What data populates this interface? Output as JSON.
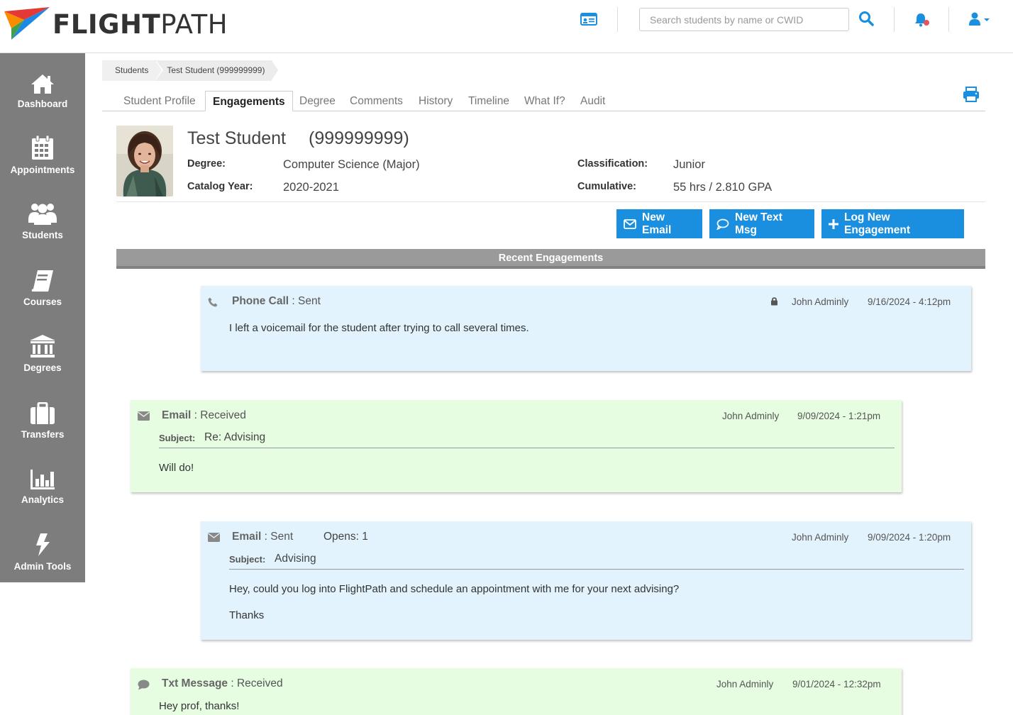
{
  "header": {
    "logo_bold": "FLIGHT",
    "logo_light": "PATH",
    "search_placeholder": "Search students by name or CWID",
    "icons": [
      "id-card-icon",
      "search-icon",
      "bell-icon",
      "user-icon"
    ]
  },
  "sidebar": {
    "items": [
      {
        "label": "Dashboard",
        "icon": "home-icon"
      },
      {
        "label": "Appointments",
        "icon": "calendar-icon"
      },
      {
        "label": "Students",
        "icon": "users-icon"
      },
      {
        "label": "Courses",
        "icon": "book-icon"
      },
      {
        "label": "Degrees",
        "icon": "university-icon"
      },
      {
        "label": "Transfers",
        "icon": "suitcase-icon"
      },
      {
        "label": "Analytics",
        "icon": "bar-chart-icon"
      },
      {
        "label": "Admin Tools",
        "icon": "bolt-icon"
      }
    ]
  },
  "breadcrumb": [
    "Students",
    "Test Student (999999999)"
  ],
  "tabs": [
    "Student Profile",
    "Engagements",
    "Degree",
    "Comments",
    "History",
    "Timeline",
    "What If?",
    "Audit"
  ],
  "active_tab": "Engagements",
  "student": {
    "name": "Test Student",
    "cwid": "(999999999)",
    "degree_label": "Degree:",
    "degree": "Computer Science (Major)",
    "catalog_label": "Catalog Year:",
    "catalog": "2020-2021",
    "class_label": "Classification:",
    "classification": "Junior",
    "cum_label": "Cumulative:",
    "cumulative": "55 hrs / 2.810 GPA"
  },
  "actions": {
    "new_email": "New Email",
    "new_text": "New Text Msg",
    "log_engagement": "Log New Engagement"
  },
  "recent_title": "Recent Engagements",
  "engagements": [
    {
      "type": "Phone Call",
      "status": ": Sent",
      "author": "John Adminly",
      "date": "9/16/2024 - 4:12pm",
      "body": "I left a voicemail for the student after trying to call several times."
    },
    {
      "type": "Email",
      "status": ": Received",
      "author": "John Adminly",
      "date": "9/09/2024 - 1:21pm",
      "subject_label": "Subject:",
      "subject": "Re: Advising",
      "body": "Will do!"
    },
    {
      "type": "Email",
      "status": ": Sent",
      "opens": "Opens: 1",
      "author": "John Adminly",
      "date": "9/09/2024 - 1:20pm",
      "subject_label": "Subject:",
      "subject": "Advising",
      "body": "Hey, could you log into FlightPath and schedule an appointment with me for your next advising?",
      "body2": "Thanks"
    },
    {
      "type": "Txt Message",
      "status": ": Received",
      "author": "John Adminly",
      "date": "9/01/2024 - 12:32pm",
      "body": "Hey prof, thanks!"
    }
  ],
  "colors": {
    "accent": "#1a8fe0",
    "sidebar": "#7d7d7d",
    "sent_bg": "#e2f3fd",
    "received_bg": "#e6fde2"
  }
}
